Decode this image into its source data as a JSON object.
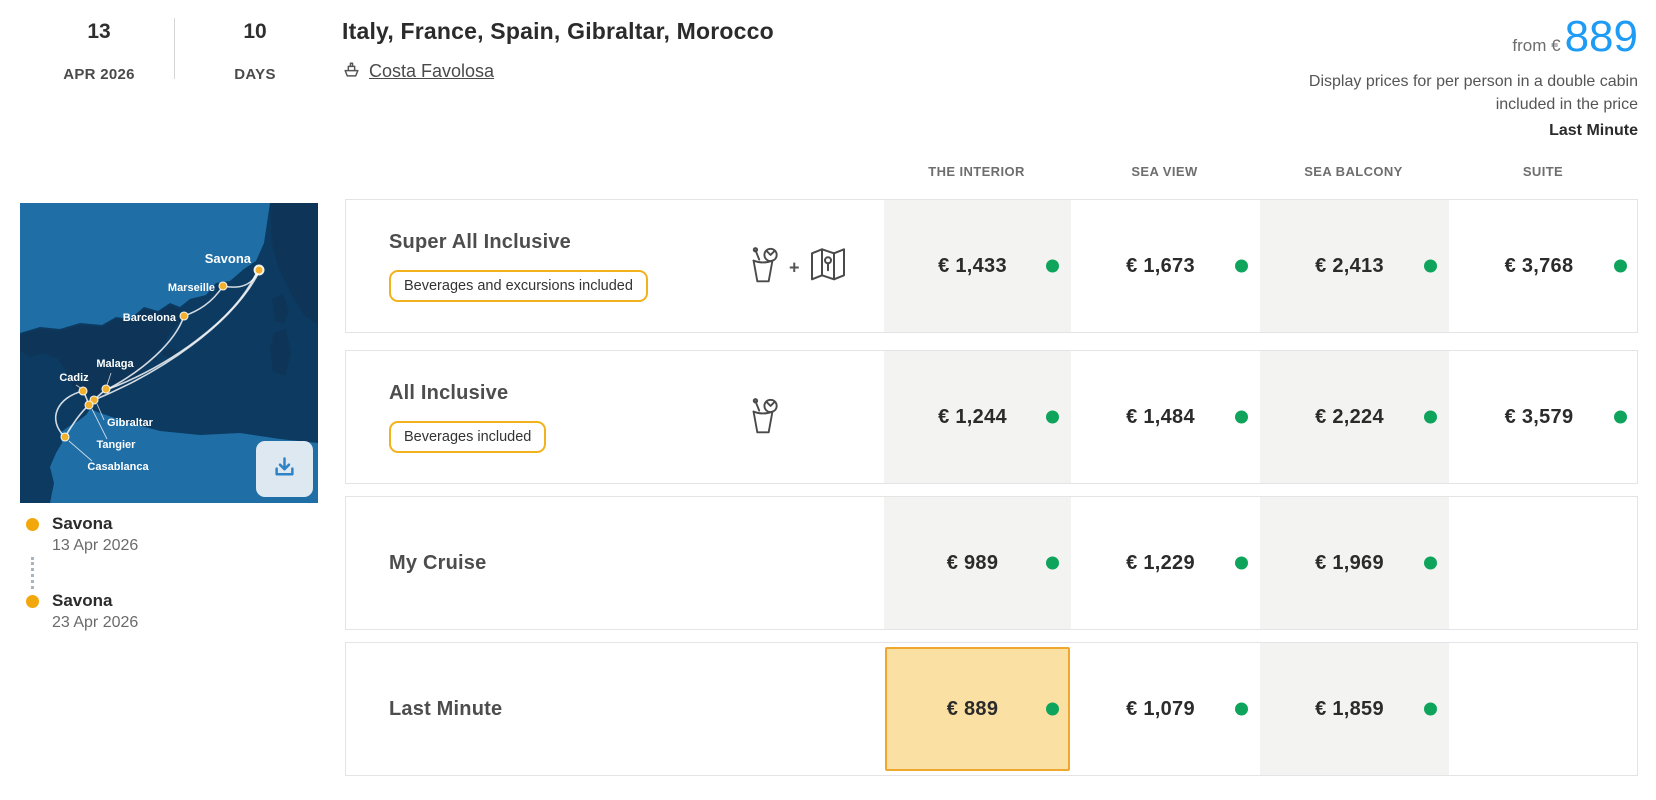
{
  "header": {
    "date_day": "13",
    "date_month_year": "APR 2026",
    "duration_value": "10",
    "duration_label": "DAYS",
    "title": "Italy, France, Spain, Gibraltar, Morocco",
    "ship_name": "Costa Favolosa",
    "from_label": "from €",
    "from_price": "889",
    "price_disclaimer": "Display prices for per person in a double cabin included in the price",
    "price_category": "Last Minute"
  },
  "map": {
    "ports": [
      "Savona",
      "Marseille",
      "Barcelona",
      "Malaga",
      "Cadiz",
      "Gibraltar",
      "Tangier",
      "Casablanca"
    ],
    "download_icon": "download-icon",
    "colors": {
      "sea": "#0C3A60",
      "land_light": "#1F6EA6",
      "land_dark": "#0E3558",
      "route": "rgba(255,255,255,0.82)",
      "port_dot": "#F2B02D"
    }
  },
  "itinerary": {
    "stops": [
      {
        "port": "Savona",
        "date": "13 Apr 2026"
      },
      {
        "port": "Savona",
        "date": "23 Apr 2026"
      }
    ]
  },
  "pricing_table": {
    "columns": [
      "THE INTERIOR",
      "SEA VIEW",
      "SEA BALCONY",
      "SUITE"
    ],
    "rows": [
      {
        "name": "Super All Inclusive",
        "badge": "Beverages and excursions included",
        "icons": [
          "drink-icon",
          "plus-icon",
          "map-icon"
        ],
        "prices": [
          "€ 1,433",
          "€ 1,673",
          "€ 2,413",
          "€ 3,768"
        ],
        "highlighted_col": null
      },
      {
        "name": "All Inclusive",
        "badge": "Beverages included",
        "icons": [
          "drink-icon"
        ],
        "prices": [
          "€ 1,244",
          "€ 1,484",
          "€ 2,224",
          "€ 3,579"
        ],
        "highlighted_col": null
      },
      {
        "name": "My Cruise",
        "badge": null,
        "icons": [],
        "prices": [
          "€ 989",
          "€ 1,229",
          "€ 1,969",
          null
        ],
        "highlighted_col": null
      },
      {
        "name": "Last Minute",
        "badge": null,
        "icons": [],
        "prices": [
          "€ 889",
          "€ 1,079",
          "€ 1,859",
          null
        ],
        "highlighted_col": 0
      }
    ]
  },
  "colors": {
    "accent_blue": "#1E9BF5",
    "availability_green": "#0FA45C",
    "badge_border": "#F2B21C",
    "highlight_bg": "#FBE0A3",
    "highlight_border": "#F0A72E",
    "column_shade": "#f3f3f2"
  }
}
